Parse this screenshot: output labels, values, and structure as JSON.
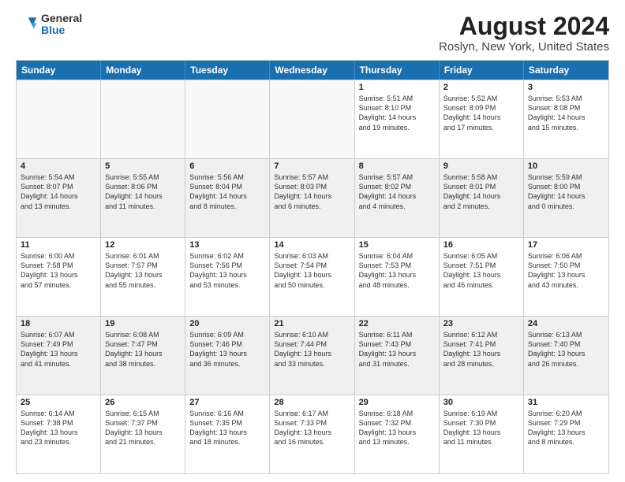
{
  "logo": {
    "general": "General",
    "blue": "Blue"
  },
  "title": "August 2024",
  "subtitle": "Roslyn, New York, United States",
  "days_of_week": [
    "Sunday",
    "Monday",
    "Tuesday",
    "Wednesday",
    "Thursday",
    "Friday",
    "Saturday"
  ],
  "weeks": [
    [
      {
        "day": "",
        "info": "",
        "empty": true
      },
      {
        "day": "",
        "info": "",
        "empty": true
      },
      {
        "day": "",
        "info": "",
        "empty": true
      },
      {
        "day": "",
        "info": "",
        "empty": true
      },
      {
        "day": "1",
        "info": "Sunrise: 5:51 AM\nSunset: 8:10 PM\nDaylight: 14 hours\nand 19 minutes.",
        "empty": false
      },
      {
        "day": "2",
        "info": "Sunrise: 5:52 AM\nSunset: 8:09 PM\nDaylight: 14 hours\nand 17 minutes.",
        "empty": false
      },
      {
        "day": "3",
        "info": "Sunrise: 5:53 AM\nSunset: 8:08 PM\nDaylight: 14 hours\nand 15 minutes.",
        "empty": false
      }
    ],
    [
      {
        "day": "4",
        "info": "Sunrise: 5:54 AM\nSunset: 8:07 PM\nDaylight: 14 hours\nand 13 minutes.",
        "empty": false
      },
      {
        "day": "5",
        "info": "Sunrise: 5:55 AM\nSunset: 8:06 PM\nDaylight: 14 hours\nand 11 minutes.",
        "empty": false
      },
      {
        "day": "6",
        "info": "Sunrise: 5:56 AM\nSunset: 8:04 PM\nDaylight: 14 hours\nand 8 minutes.",
        "empty": false
      },
      {
        "day": "7",
        "info": "Sunrise: 5:57 AM\nSunset: 8:03 PM\nDaylight: 14 hours\nand 6 minutes.",
        "empty": false
      },
      {
        "day": "8",
        "info": "Sunrise: 5:57 AM\nSunset: 8:02 PM\nDaylight: 14 hours\nand 4 minutes.",
        "empty": false
      },
      {
        "day": "9",
        "info": "Sunrise: 5:58 AM\nSunset: 8:01 PM\nDaylight: 14 hours\nand 2 minutes.",
        "empty": false
      },
      {
        "day": "10",
        "info": "Sunrise: 5:59 AM\nSunset: 8:00 PM\nDaylight: 14 hours\nand 0 minutes.",
        "empty": false
      }
    ],
    [
      {
        "day": "11",
        "info": "Sunrise: 6:00 AM\nSunset: 7:58 PM\nDaylight: 13 hours\nand 57 minutes.",
        "empty": false
      },
      {
        "day": "12",
        "info": "Sunrise: 6:01 AM\nSunset: 7:57 PM\nDaylight: 13 hours\nand 55 minutes.",
        "empty": false
      },
      {
        "day": "13",
        "info": "Sunrise: 6:02 AM\nSunset: 7:56 PM\nDaylight: 13 hours\nand 53 minutes.",
        "empty": false
      },
      {
        "day": "14",
        "info": "Sunrise: 6:03 AM\nSunset: 7:54 PM\nDaylight: 13 hours\nand 50 minutes.",
        "empty": false
      },
      {
        "day": "15",
        "info": "Sunrise: 6:04 AM\nSunset: 7:53 PM\nDaylight: 13 hours\nand 48 minutes.",
        "empty": false
      },
      {
        "day": "16",
        "info": "Sunrise: 6:05 AM\nSunset: 7:51 PM\nDaylight: 13 hours\nand 46 minutes.",
        "empty": false
      },
      {
        "day": "17",
        "info": "Sunrise: 6:06 AM\nSunset: 7:50 PM\nDaylight: 13 hours\nand 43 minutes.",
        "empty": false
      }
    ],
    [
      {
        "day": "18",
        "info": "Sunrise: 6:07 AM\nSunset: 7:49 PM\nDaylight: 13 hours\nand 41 minutes.",
        "empty": false
      },
      {
        "day": "19",
        "info": "Sunrise: 6:08 AM\nSunset: 7:47 PM\nDaylight: 13 hours\nand 38 minutes.",
        "empty": false
      },
      {
        "day": "20",
        "info": "Sunrise: 6:09 AM\nSunset: 7:46 PM\nDaylight: 13 hours\nand 36 minutes.",
        "empty": false
      },
      {
        "day": "21",
        "info": "Sunrise: 6:10 AM\nSunset: 7:44 PM\nDaylight: 13 hours\nand 33 minutes.",
        "empty": false
      },
      {
        "day": "22",
        "info": "Sunrise: 6:11 AM\nSunset: 7:43 PM\nDaylight: 13 hours\nand 31 minutes.",
        "empty": false
      },
      {
        "day": "23",
        "info": "Sunrise: 6:12 AM\nSunset: 7:41 PM\nDaylight: 13 hours\nand 28 minutes.",
        "empty": false
      },
      {
        "day": "24",
        "info": "Sunrise: 6:13 AM\nSunset: 7:40 PM\nDaylight: 13 hours\nand 26 minutes.",
        "empty": false
      }
    ],
    [
      {
        "day": "25",
        "info": "Sunrise: 6:14 AM\nSunset: 7:38 PM\nDaylight: 13 hours\nand 23 minutes.",
        "empty": false
      },
      {
        "day": "26",
        "info": "Sunrise: 6:15 AM\nSunset: 7:37 PM\nDaylight: 13 hours\nand 21 minutes.",
        "empty": false
      },
      {
        "day": "27",
        "info": "Sunrise: 6:16 AM\nSunset: 7:35 PM\nDaylight: 13 hours\nand 18 minutes.",
        "empty": false
      },
      {
        "day": "28",
        "info": "Sunrise: 6:17 AM\nSunset: 7:33 PM\nDaylight: 13 hours\nand 16 minutes.",
        "empty": false
      },
      {
        "day": "29",
        "info": "Sunrise: 6:18 AM\nSunset: 7:32 PM\nDaylight: 13 hours\nand 13 minutes.",
        "empty": false
      },
      {
        "day": "30",
        "info": "Sunrise: 6:19 AM\nSunset: 7:30 PM\nDaylight: 13 hours\nand 11 minutes.",
        "empty": false
      },
      {
        "day": "31",
        "info": "Sunrise: 6:20 AM\nSunset: 7:29 PM\nDaylight: 13 hours\nand 8 minutes.",
        "empty": false
      }
    ]
  ]
}
